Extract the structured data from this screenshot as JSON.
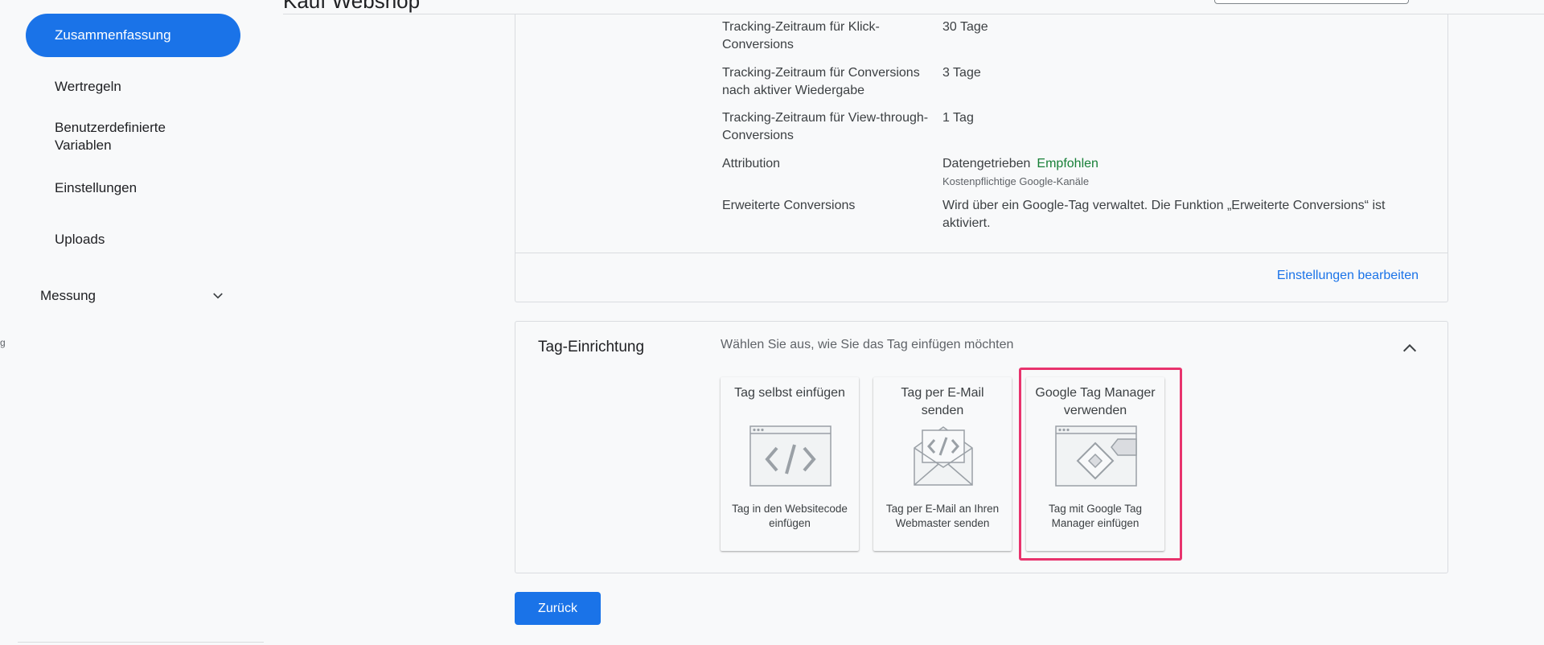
{
  "topbar": {
    "title": "Kauf Webshop"
  },
  "sidebar": {
    "active_item": "Zusammenfassung",
    "items": [
      {
        "label": "Wertregeln"
      },
      {
        "label": "Benutzerdefinierte Variablen"
      },
      {
        "label": "Einstellungen"
      },
      {
        "label": "Uploads"
      }
    ],
    "group": {
      "label": "Messung",
      "icon": "chevron-down-icon"
    },
    "stub_text": "g"
  },
  "settings": {
    "rows": [
      {
        "label": "Tracking-Zeitraum für Klick-Conversions",
        "value": "30 Tage"
      },
      {
        "label": "Tracking-Zeitraum für Conversions nach aktiver Wiedergabe",
        "value": "3 Tage"
      },
      {
        "label": "Tracking-Zeitraum für View-through-Conversions",
        "value": "1 Tag"
      },
      {
        "label": "Attribution",
        "value": "Datengetrieben",
        "badge": "Empfohlen",
        "note": "Kostenpflichtige Google-Kanäle"
      },
      {
        "label": "Erweiterte Conversions",
        "value": "Wird über ein Google-Tag verwaltet.  Die Funktion „Erweiterte Conversions“ ist aktiviert."
      }
    ],
    "edit_link": "Einstellungen bearbeiten"
  },
  "tag_setup": {
    "title": "Tag-Einrichtung",
    "subtitle": "Wählen Sie aus, wie Sie das Tag einfügen möchten",
    "options": [
      {
        "title": "Tag selbst einfügen",
        "description": "Tag in den Websitecode einfügen",
        "icon": "code-window-icon"
      },
      {
        "title": "Tag per E-Mail senden",
        "description": "Tag per E-Mail an Ihren Webmaster senden",
        "icon": "email-code-icon"
      },
      {
        "title": "Google Tag Manager verwenden",
        "description": "Tag mit Google Tag Manager einfügen",
        "icon": "tag-manager-icon"
      }
    ]
  },
  "footer": {
    "back_label": "Zurück"
  },
  "colors": {
    "accent": "#1a73e8",
    "recommended": "#188038",
    "highlight": "#e8336d"
  }
}
